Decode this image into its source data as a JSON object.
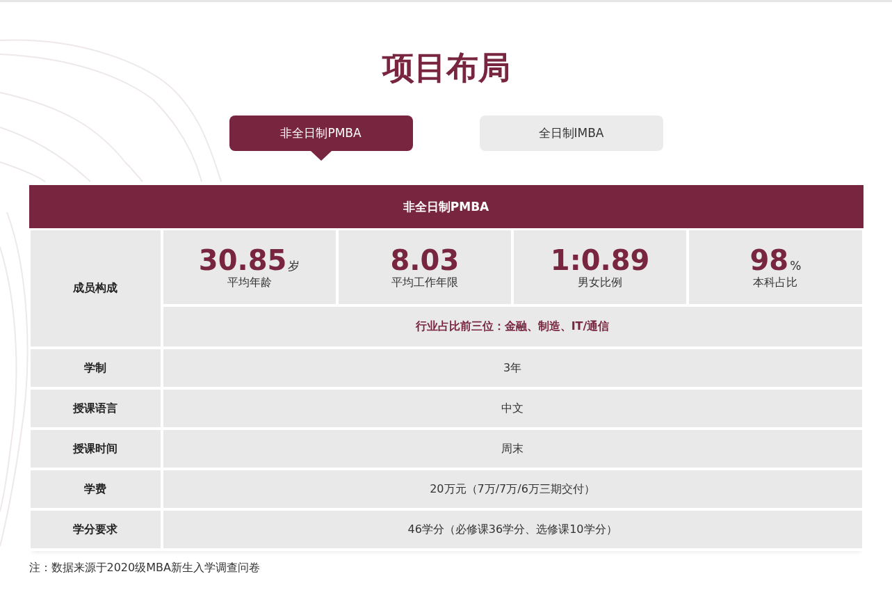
{
  "title": "项目布局",
  "tabs": [
    {
      "label": "非全日制PMBA",
      "selected": true
    },
    {
      "label": "全日制IMBA",
      "selected": false
    }
  ],
  "table": {
    "header": "非全日制PMBA",
    "composition": {
      "label": "成员构成",
      "stats": [
        {
          "value": "30.85",
          "unit": "岁",
          "label": "平均年龄"
        },
        {
          "value": "8.03",
          "label": "平均工作年限"
        },
        {
          "value": "1:0.89",
          "label": "男女比例"
        },
        {
          "value": "98",
          "unit": "%",
          "label": "本科占比"
        }
      ],
      "industry": "行业占比前三位：金融、制造、IT/通信"
    },
    "rows": [
      {
        "label": "学制",
        "value": "3年"
      },
      {
        "label": "授课语言",
        "value": "中文"
      },
      {
        "label": "授课时间",
        "value": "周末"
      },
      {
        "label": "学费",
        "value": "20万元（7万/7万/6万三期交付）"
      },
      {
        "label": "学分要求",
        "value": "46学分（必修课36学分、选修课10学分）"
      }
    ]
  },
  "note": "注：数据来源于2020级MBA新生入学调查问卷"
}
